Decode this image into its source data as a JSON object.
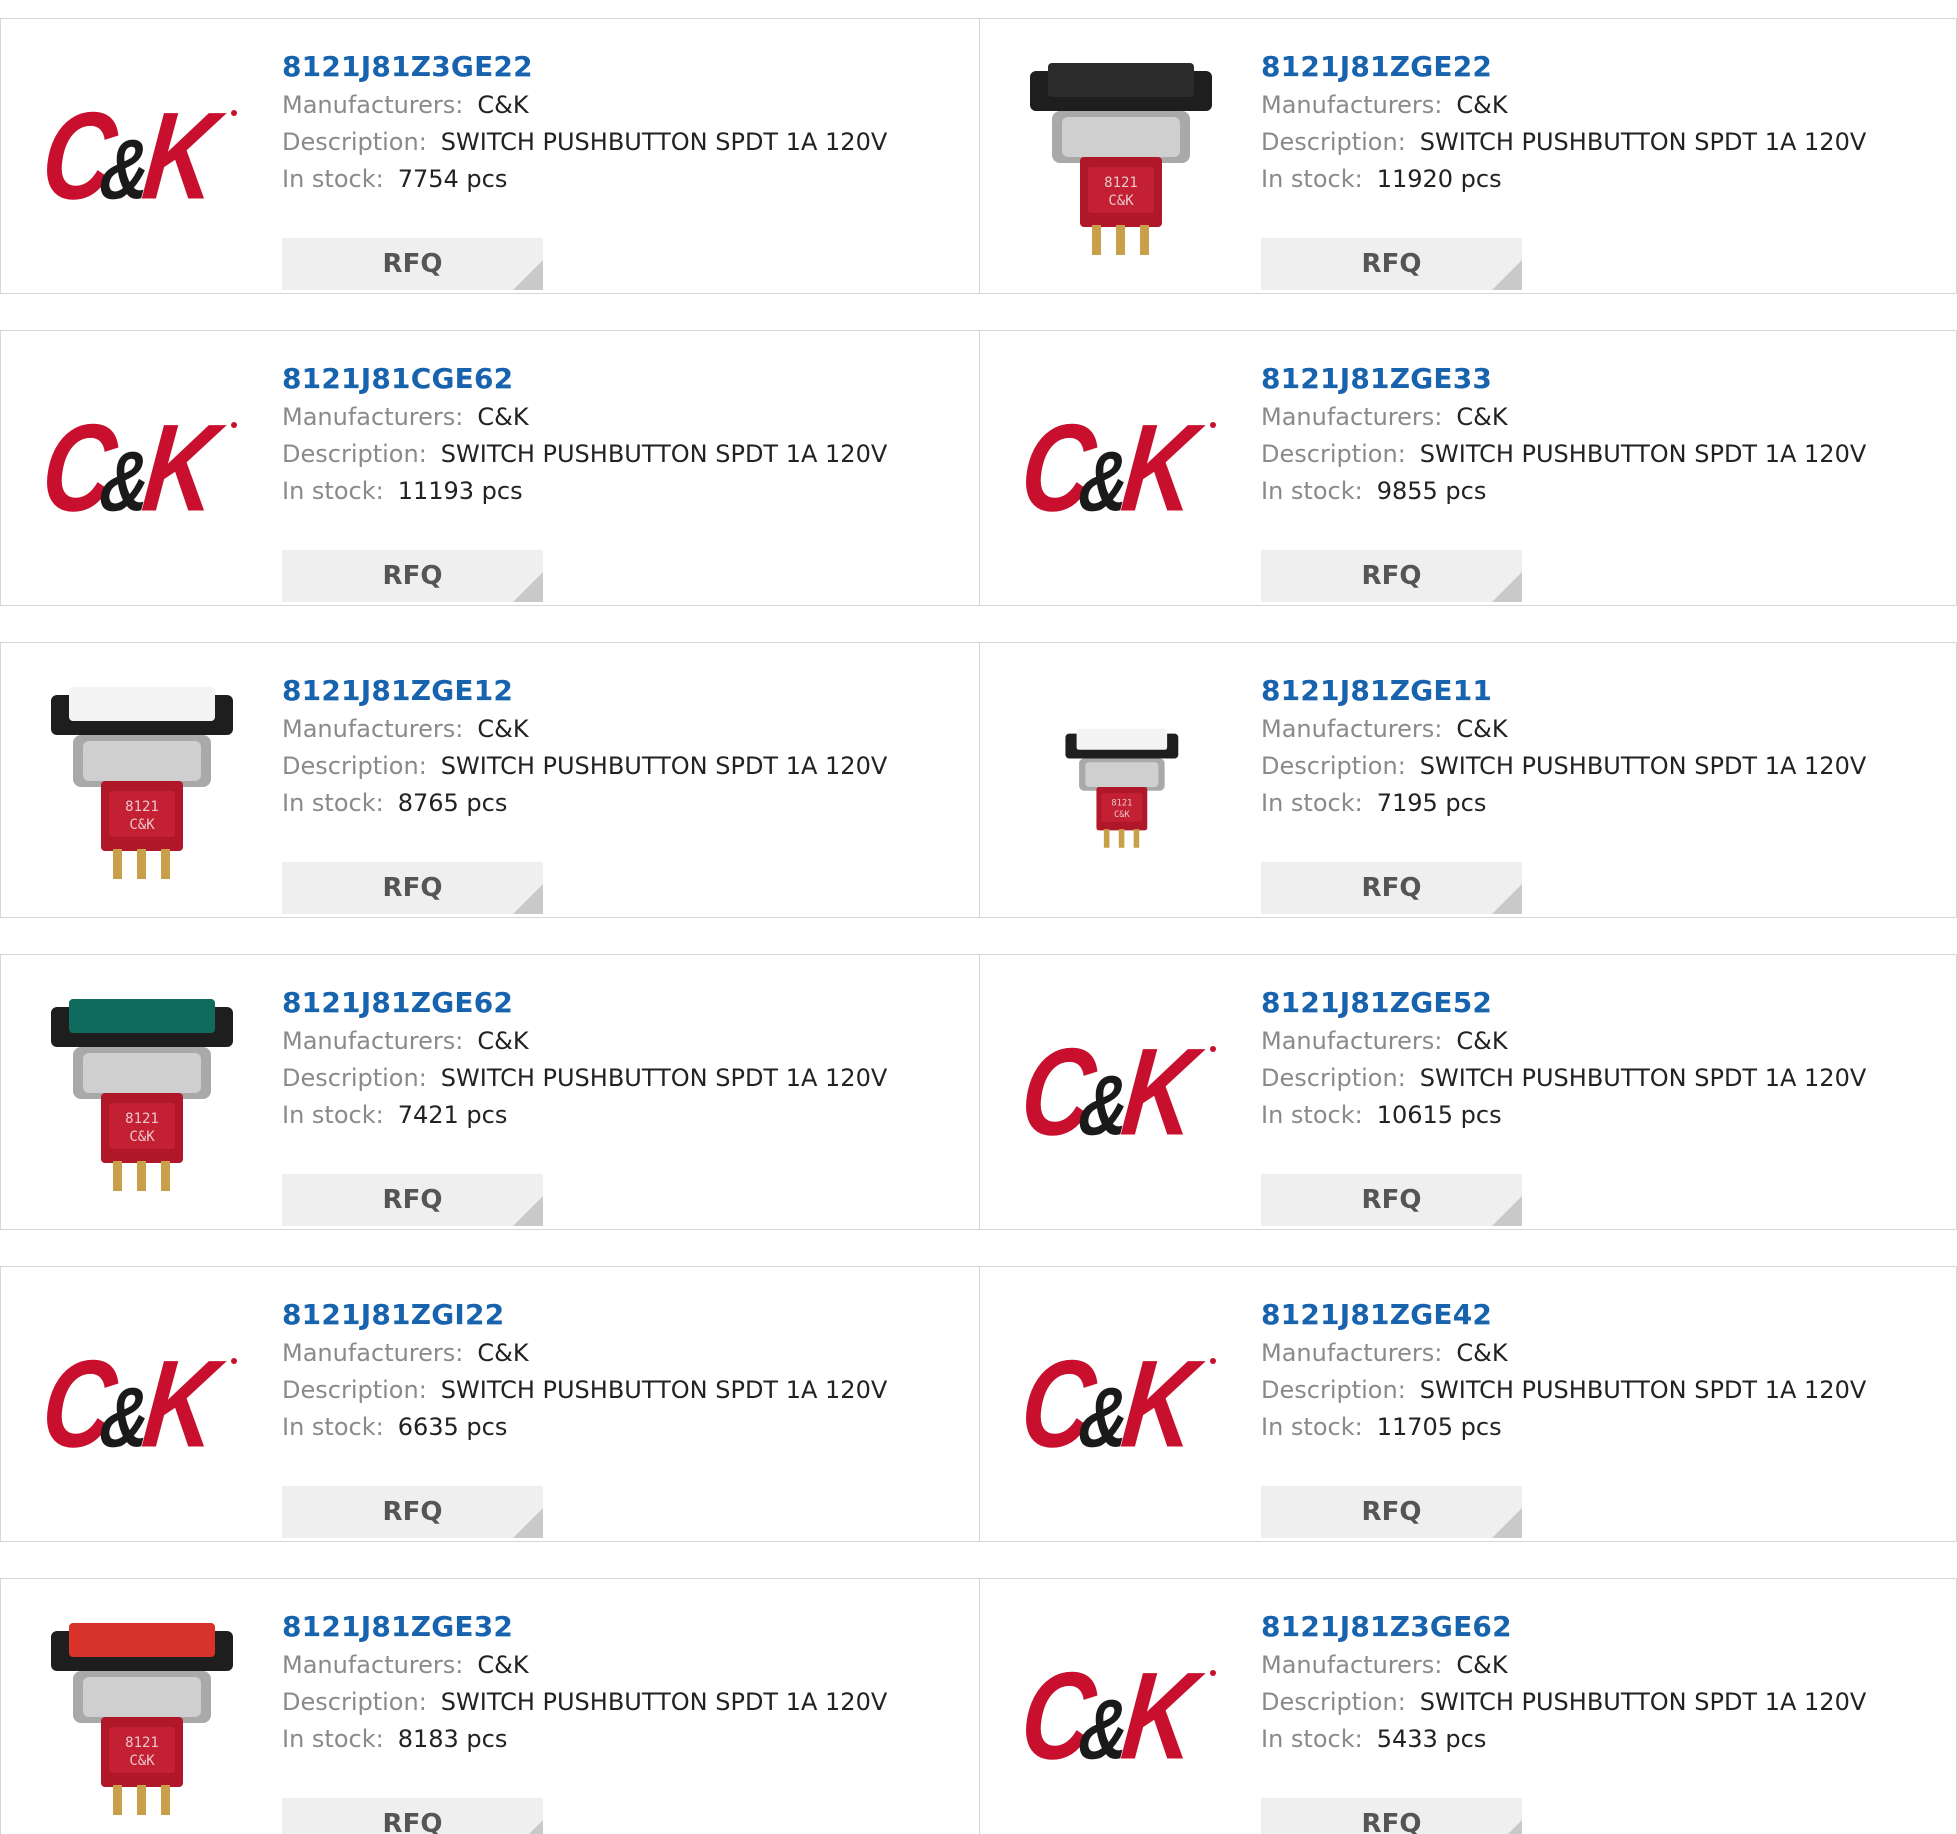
{
  "labels": {
    "manufacturer": "Manufacturers:",
    "description": "Description:",
    "stock": "In stock:",
    "rfq": "RFQ",
    "logo_text": "C&K"
  },
  "colors": {
    "part_link": "#1763ad",
    "logo_red": "#c8102e",
    "logo_ampersand": "#1a1a1a",
    "rfq_bg": "#efefef",
    "border": "#d6d6d6"
  },
  "products": [
    {
      "part": "8121J81Z3GE22",
      "manufacturer": "C&K",
      "description": "SWITCH PUSHBUTTON SPDT 1A 120V",
      "stock": "7754 pcs",
      "image": "ck-logo"
    },
    {
      "part": "8121J81ZGE22",
      "manufacturer": "C&K",
      "description": "SWITCH PUSHBUTTON SPDT 1A 120V",
      "stock": "11920 pcs",
      "image": "switch-black-cap"
    },
    {
      "part": "8121J81CGE62",
      "manufacturer": "C&K",
      "description": "SWITCH PUSHBUTTON SPDT 1A 120V",
      "stock": "11193 pcs",
      "image": "ck-logo"
    },
    {
      "part": "8121J81ZGE33",
      "manufacturer": "C&K",
      "description": "SWITCH PUSHBUTTON SPDT 1A 120V",
      "stock": "9855 pcs",
      "image": "ck-logo"
    },
    {
      "part": "8121J81ZGE12",
      "manufacturer": "C&K",
      "description": "SWITCH PUSHBUTTON SPDT 1A 120V",
      "stock": "8765 pcs",
      "image": "switch-white-cap"
    },
    {
      "part": "8121J81ZGE11",
      "manufacturer": "C&K",
      "description": "SWITCH PUSHBUTTON SPDT 1A 120V",
      "stock": "7195 pcs",
      "image": "switch-white-cap-small"
    },
    {
      "part": "8121J81ZGE62",
      "manufacturer": "C&K",
      "description": "SWITCH PUSHBUTTON SPDT 1A 120V",
      "stock": "7421 pcs",
      "image": "switch-green-cap"
    },
    {
      "part": "8121J81ZGE52",
      "manufacturer": "C&K",
      "description": "SWITCH PUSHBUTTON SPDT 1A 120V",
      "stock": "10615 pcs",
      "image": "ck-logo"
    },
    {
      "part": "8121J81ZGI22",
      "manufacturer": "C&K",
      "description": "SWITCH PUSHBUTTON SPDT 1A 120V",
      "stock": "6635 pcs",
      "image": "ck-logo"
    },
    {
      "part": "8121J81ZGE42",
      "manufacturer": "C&K",
      "description": "SWITCH PUSHBUTTON SPDT 1A 120V",
      "stock": "11705 pcs",
      "image": "ck-logo"
    },
    {
      "part": "8121J81ZGE32",
      "manufacturer": "C&K",
      "description": "SWITCH PUSHBUTTON SPDT 1A 120V",
      "stock": "8183 pcs",
      "image": "switch-red-cap"
    },
    {
      "part": "8121J81Z3GE62",
      "manufacturer": "C&K",
      "description": "SWITCH PUSHBUTTON SPDT 1A 120V",
      "stock": "5433 pcs",
      "image": "ck-logo"
    }
  ]
}
